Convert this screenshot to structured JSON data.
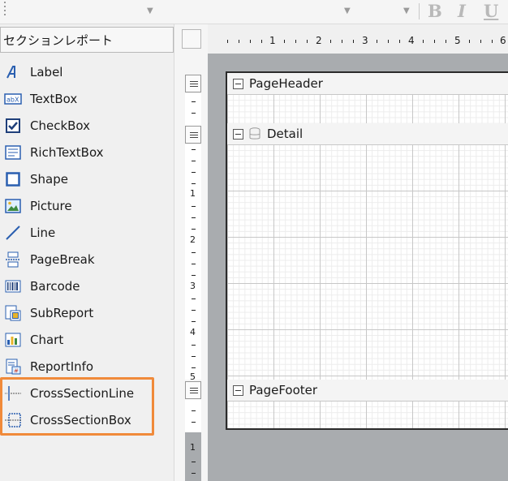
{
  "toolbar": {
    "format_bold": "B",
    "format_italic": "I",
    "format_underline": "U"
  },
  "toolbox": {
    "report_type": "セクションレポート",
    "items": [
      {
        "label": "Label",
        "icon": "label-icon"
      },
      {
        "label": "TextBox",
        "icon": "textbox-icon"
      },
      {
        "label": "CheckBox",
        "icon": "checkbox-icon"
      },
      {
        "label": "RichTextBox",
        "icon": "richtextbox-icon"
      },
      {
        "label": "Shape",
        "icon": "shape-icon"
      },
      {
        "label": "Picture",
        "icon": "picture-icon"
      },
      {
        "label": "Line",
        "icon": "line-icon"
      },
      {
        "label": "PageBreak",
        "icon": "pagebreak-icon"
      },
      {
        "label": "Barcode",
        "icon": "barcode-icon"
      },
      {
        "label": "SubReport",
        "icon": "subreport-icon"
      },
      {
        "label": "Chart",
        "icon": "chart-icon"
      },
      {
        "label": "ReportInfo",
        "icon": "reportinfo-icon"
      },
      {
        "label": "CrossSectionLine",
        "icon": "crosssectionline-icon"
      },
      {
        "label": "CrossSectionBox",
        "icon": "crosssectionbox-icon"
      }
    ],
    "highlight_color": "#f08a3a"
  },
  "ruler": {
    "h_numbers": [
      "1",
      "2",
      "3",
      "4",
      "5",
      "6"
    ],
    "v_numbers": [
      "1",
      "2",
      "3",
      "4",
      "5"
    ],
    "v_footer_number": "1"
  },
  "designer": {
    "bands": {
      "page_header": "PageHeader",
      "detail": "Detail",
      "page_footer": "PageFooter"
    }
  }
}
